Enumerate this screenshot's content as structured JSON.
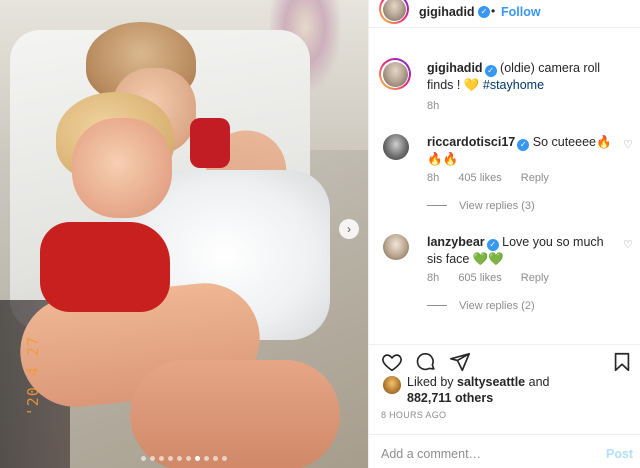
{
  "header": {
    "username": "gigihadid",
    "separator": "•",
    "follow_label": "Follow"
  },
  "caption": {
    "username": "gigihadid",
    "text": "(oldie) camera roll finds ! 💛",
    "hashtag": "#stayhome",
    "time": "8h"
  },
  "comments": [
    {
      "username": "riccardotisci17",
      "text": "So cuteeee🔥🔥🔥",
      "time": "8h",
      "likes": "405 likes",
      "reply_label": "Reply",
      "view_replies": "View replies (3)"
    },
    {
      "username": "lanzybear",
      "text": "Love you so much sis face 💚💚",
      "time": "8h",
      "likes": "605 likes",
      "reply_label": "Reply",
      "view_replies": "View replies (2)"
    }
  ],
  "likes": {
    "prefix": "Liked by ",
    "user": "saltyseattle",
    "conj": " and",
    "count": "882,711 others"
  },
  "timestamp": "8 HOURS AGO",
  "add_comment": {
    "placeholder": "Add a comment…",
    "post_label": "Post"
  },
  "photo": {
    "date_stamp": "'20 4 27",
    "carousel_total": 10,
    "carousel_active": 7
  },
  "icons": {
    "verified": "verified-badge-icon",
    "like": "heart-icon",
    "comment": "comment-bubble-icon",
    "share": "paper-plane-icon",
    "save": "bookmark-icon",
    "next": "chevron-right-icon"
  },
  "colors": {
    "link_blue": "#3897f0",
    "muted": "#8e8e8e",
    "post_disabled": "#b2dffc"
  }
}
